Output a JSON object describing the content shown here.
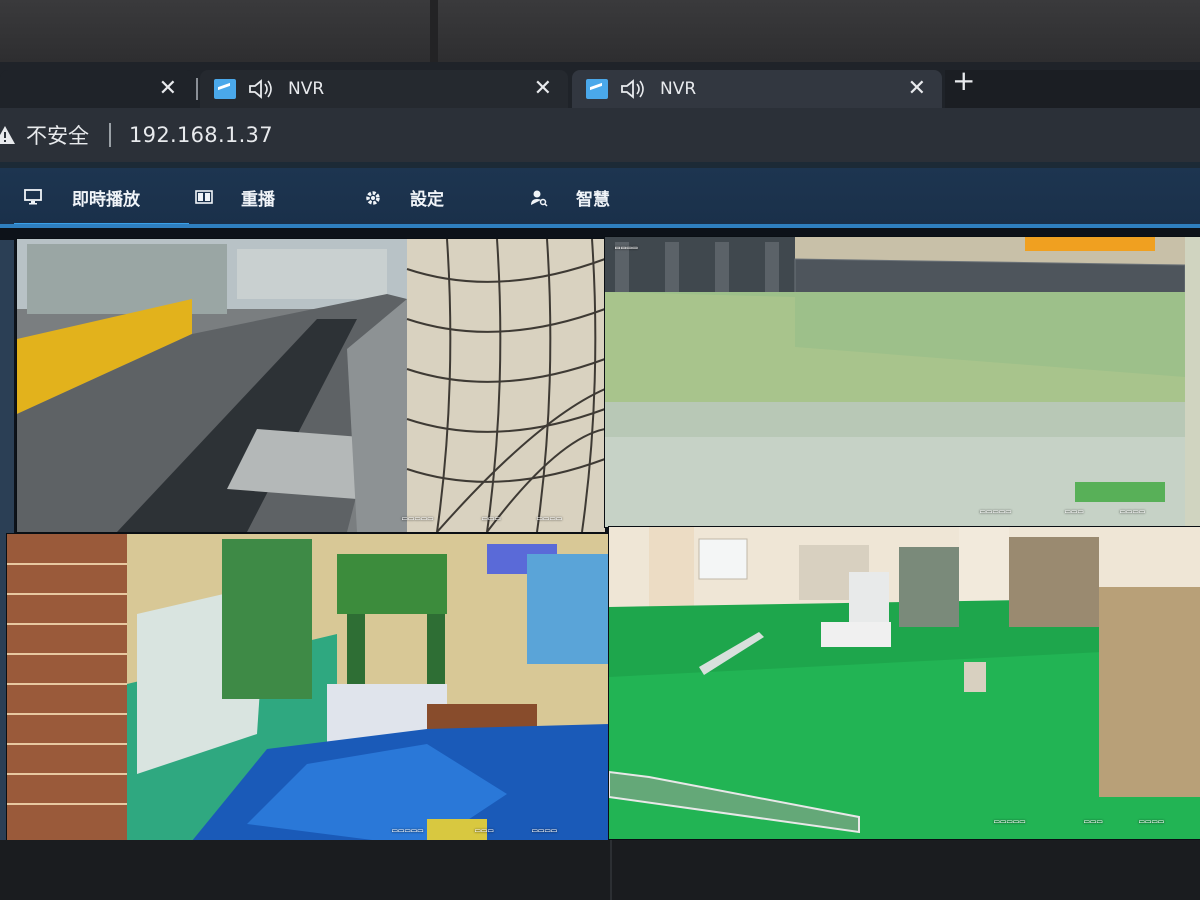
{
  "browser": {
    "tabs": [
      {
        "title": "NVR",
        "muted_icon": "speaker-icon"
      },
      {
        "title": "NVR",
        "muted_icon": "speaker-icon",
        "active": true
      }
    ],
    "close_glyph": "✕",
    "new_tab_glyph": "+",
    "security_label": "不安全",
    "url": "192.168.1.37"
  },
  "nav": {
    "items": [
      {
        "label": "即時播放",
        "icon": "monitor-icon",
        "active": true
      },
      {
        "label": "重播",
        "icon": "playback-icon"
      },
      {
        "label": "設定",
        "icon": "gear-icon"
      },
      {
        "label": "智慧",
        "icon": "user-search-icon"
      }
    ]
  },
  "cameras": [
    {
      "id": "cam1",
      "scene": "alley"
    },
    {
      "id": "cam2",
      "scene": "canal"
    },
    {
      "id": "cam3",
      "scene": "workshop"
    },
    {
      "id": "cam4",
      "scene": "factory-floor"
    }
  ],
  "colors": {
    "tab_bar": "#1f2329",
    "address_bar": "#2b3038",
    "nav_bar": "#1d3550",
    "nav_accent": "#3aa0e8",
    "favicon": "#4aa8ea"
  }
}
